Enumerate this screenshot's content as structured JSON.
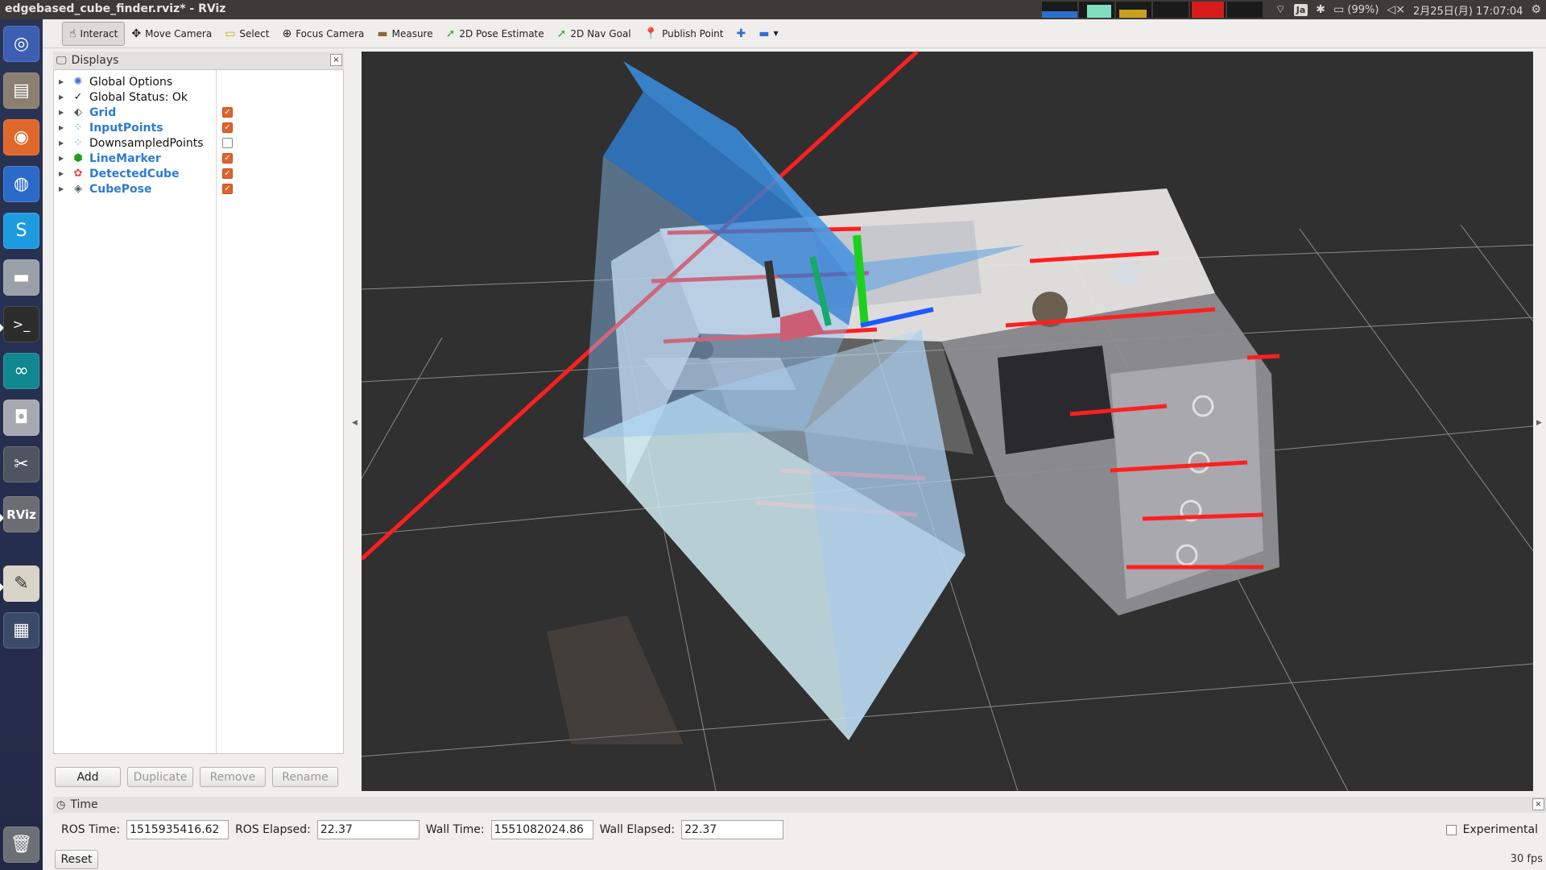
{
  "window": {
    "title": "edgebased_cube_finder.rviz* - RViz"
  },
  "indicators": {
    "lang": "Ja",
    "battery": "(99%)",
    "datetime": "2月25日(月) 17:07:04"
  },
  "toolbar": {
    "tools": [
      {
        "label": "Interact",
        "icon": "hand-icon"
      },
      {
        "label": "Move Camera",
        "icon": "move-icon"
      },
      {
        "label": "Select",
        "icon": "select-icon"
      },
      {
        "label": "Focus Camera",
        "icon": "focus-icon"
      },
      {
        "label": "Measure",
        "icon": "ruler-icon"
      },
      {
        "label": "2D Pose Estimate",
        "icon": "green-arrow-icon"
      },
      {
        "label": "2D Nav Goal",
        "icon": "green-arrow-icon"
      },
      {
        "label": "Publish Point",
        "icon": "pin-icon"
      }
    ]
  },
  "displays": {
    "title": "Displays",
    "items": [
      {
        "label": "Global Options",
        "enabled": null
      },
      {
        "label": "Global Status: Ok",
        "enabled": null
      },
      {
        "label": "Grid",
        "enabled": true
      },
      {
        "label": "InputPoints",
        "enabled": true
      },
      {
        "label": "DownsampledPoints",
        "enabled": false
      },
      {
        "label": "LineMarker",
        "enabled": true
      },
      {
        "label": "DetectedCube",
        "enabled": true
      },
      {
        "label": "CubePose",
        "enabled": true
      }
    ],
    "buttons": {
      "add": "Add",
      "duplicate": "Duplicate",
      "remove": "Remove",
      "rename": "Rename"
    }
  },
  "time": {
    "title": "Time",
    "ros_time_label": "ROS Time:",
    "ros_time": "1515935416.62",
    "ros_elapsed_label": "ROS Elapsed:",
    "ros_elapsed": "22.37",
    "wall_time_label": "Wall Time:",
    "wall_time": "1551082024.86",
    "wall_elapsed_label": "Wall Elapsed:",
    "wall_elapsed": "22.37",
    "experimental": "Experimental",
    "reset": "Reset",
    "fps": "30 fps"
  },
  "colors": {
    "accent_check": "#e0622b",
    "enabled_label": "#2e7bd0",
    "view_bg": "#303030",
    "cube_blue": "#3a8fe0",
    "cube_light": "#cfeaf2",
    "marker_red": "#ff1f1f"
  }
}
